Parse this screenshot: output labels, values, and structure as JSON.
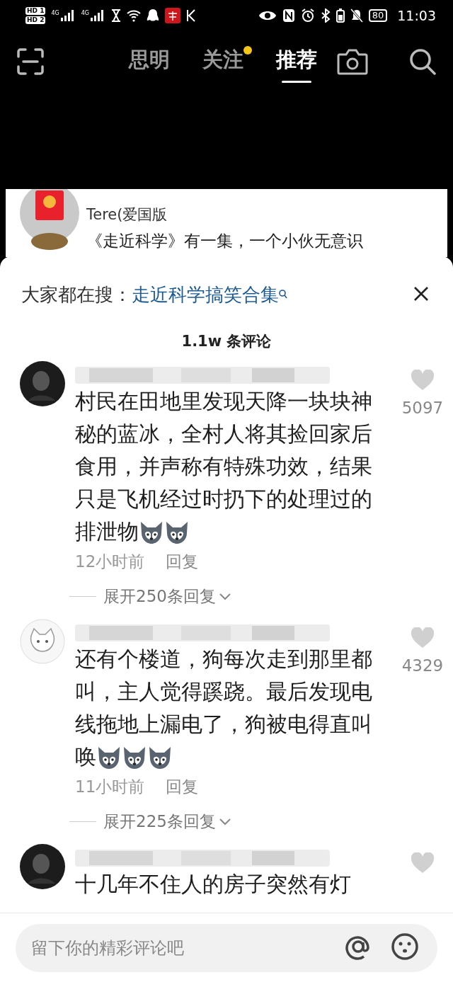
{
  "status_bar": {
    "sim_labels": [
      "HD 1",
      "HD 2"
    ],
    "networks": [
      "4G",
      "4G"
    ],
    "battery": "80",
    "time": "11:03"
  },
  "top_nav": {
    "tabs": [
      {
        "label": "思明",
        "selected": false,
        "dot": false
      },
      {
        "label": "关注",
        "selected": false,
        "dot": true
      },
      {
        "label": "推荐",
        "selected": true,
        "dot": false
      }
    ]
  },
  "video_card": {
    "author": "Tere(爱国版",
    "text": "《走近科学》有一集，一个小伙无意识"
  },
  "search_hint": {
    "label": "大家都在搜：",
    "query": "走近科学搞笑合集"
  },
  "comments_header": "1.1w 条评论",
  "comments": [
    {
      "text": "村民在田地里发现天降一块块神秘的蓝冰，全村人将其捡回家后食用，并声称有特殊功效，结果只是飞机经过时扔下的处理过的排泄物",
      "emojis": [
        {
          "kind": "husky"
        },
        {
          "kind": "husky"
        }
      ],
      "time": "12小时前",
      "reply": "回复",
      "expand": "展开250条回复",
      "likes": "5097"
    },
    {
      "text": "还有个楼道，狗每次走到那里都叫，主人觉得蹊跷。最后发现电线拖地上漏电了，狗被电得直叫唤",
      "emojis": [
        {
          "kind": "husky"
        },
        {
          "kind": "husky"
        },
        {
          "kind": "husky"
        }
      ],
      "time": "11小时前",
      "reply": "回复",
      "expand": "展开225条回复",
      "likes": "4329"
    },
    {
      "text": "十几年不住人的房子突然有灯"
    }
  ],
  "input": {
    "placeholder": "留下你的精彩评论吧"
  }
}
